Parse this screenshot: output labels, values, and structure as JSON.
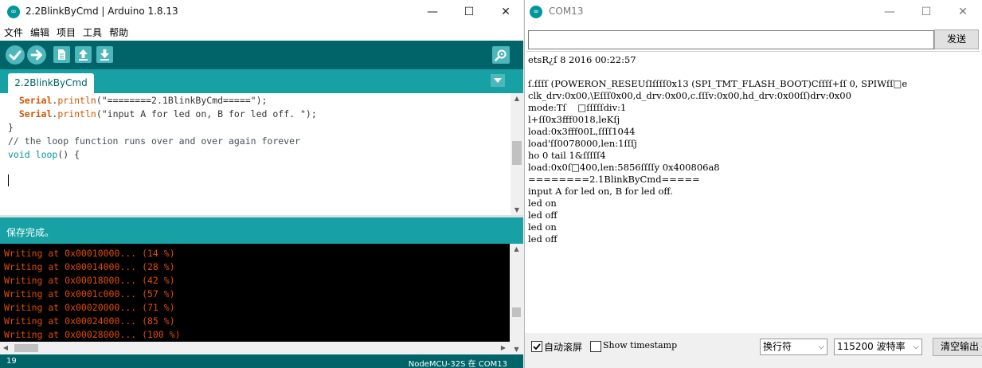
{
  "ide": {
    "title": "2.2BlinkByCmd | Arduino 1.8.13",
    "menu": [
      "文件",
      "编辑",
      "项目",
      "工具",
      "帮助"
    ],
    "toolbar": {
      "verify": "verify-icon",
      "upload": "upload-icon",
      "new": "new-icon",
      "open": "open-icon",
      "save": "save-icon",
      "serial_monitor": "serial-monitor-icon"
    },
    "tab_label": "2.2BlinkByCmd",
    "code": {
      "l1_obj": "Serial",
      "l1_fn": "println",
      "l1_arg": "(\"========2.1BlinkByCmd=====\");",
      "l2_obj": "Serial",
      "l2_fn": "println",
      "l2_arg": "(\"input A for led on, B for led off. \");",
      "l3": "}",
      "l4": "// the loop function runs over and over again forever",
      "l5_type": "void",
      "l5_fn": "loop",
      "l5_rest": "() {"
    },
    "status_message": "保存完成。",
    "console_lines": [
      "Writing at 0x00010000... (14 %)",
      "Writing at 0x00014000... (28 %)",
      "Writing at 0x00018000... (42 %)",
      "Writing at 0x0001c000... (57 %)",
      "Writing at 0x00020000... (71 %)",
      "Writing at 0x00024000... (85 %)",
      "Writing at 0x00028000... (100 %)"
    ],
    "line_number": "19",
    "board": "NodeMCU-32S 在 COM13"
  },
  "serial": {
    "title": "COM13",
    "input_value": "",
    "send_label": "发送",
    "output_lines": [
      "etsR¿ſ 8 2016 00:22:57",
      "",
      "ſ.ſſſſ (POWERON_RESEUſIſſſſ0x13 (SPI_TMT_FLASH_BOOT)Cſſſſ+ſſ 0, SPIWſſ□e",
      "clk_drv:0x00,\\Eſſſ0x00,d_drv:0x00,c.ſſſv:0x00,hd_drv:0x00ſſ)drv:0x00",
      "mode:Tſ    □ſſſſſdiv:1",
      "l+ſſ0x3fff0018,leKſj",
      "load:0x3fff00L,ſſſſ1044",
      "load'ſſ0078000,len:1ſſſj",
      "ho 0 tail 1&ſſſſſ4",
      "load:0x0ſ□400,len:5856ſſſſy 0x400806a8",
      "========2.1BlinkByCmd=====",
      "input A for led on, B for led off.",
      "led on",
      "led off",
      "led on",
      "led off"
    ],
    "autoscroll_label": "自动滚屏",
    "autoscroll_checked": true,
    "timestamp_label": "Show timestamp",
    "timestamp_checked": false,
    "line_ending": "换行符",
    "baud": "115200 波特率",
    "clear_label": "清空输出"
  },
  "colors": {
    "arduino_teal": "#00979c",
    "toolbar_dark": "#006468",
    "tab_bar": "#17a1a5",
    "console_text": "#e34c00"
  }
}
